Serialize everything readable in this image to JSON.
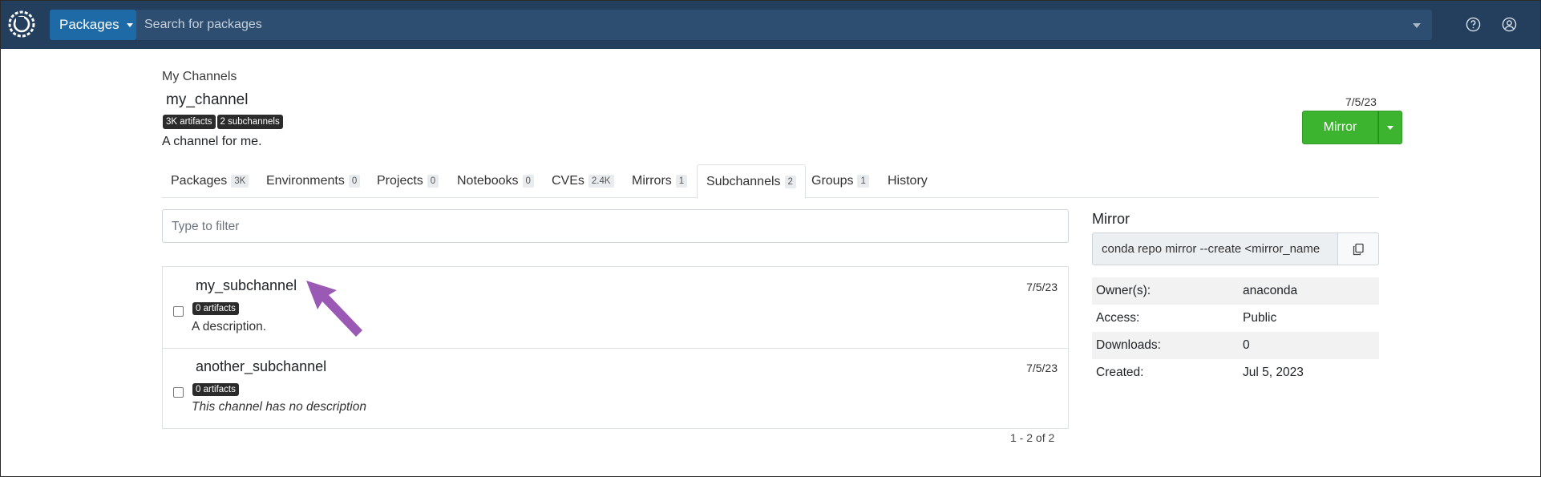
{
  "topbar": {
    "packages_label": "Packages",
    "search_placeholder": "Search for packages"
  },
  "header": {
    "breadcrumb": "My Channels",
    "title": "my_channel",
    "badges": [
      "3K artifacts",
      "2 subchannels"
    ],
    "description": "A channel for me.",
    "date": "7/5/23",
    "mirror_label": "Mirror"
  },
  "tabs": [
    {
      "label": "Packages",
      "count": "3K"
    },
    {
      "label": "Environments",
      "count": "0"
    },
    {
      "label": "Projects",
      "count": "0"
    },
    {
      "label": "Notebooks",
      "count": "0"
    },
    {
      "label": "CVEs",
      "count": "2.4K"
    },
    {
      "label": "Mirrors",
      "count": "1"
    },
    {
      "label": "Subchannels",
      "count": "2",
      "active": true
    },
    {
      "label": "Groups",
      "count": "1"
    },
    {
      "label": "History",
      "count": ""
    }
  ],
  "filter": {
    "placeholder": "Type to filter"
  },
  "subchannels": [
    {
      "name": "my_subchannel",
      "badge": "0 artifacts",
      "description": "A description.",
      "date": "7/5/23"
    },
    {
      "name": "another_subchannel",
      "badge": "0 artifacts",
      "description": "This channel has no description",
      "date": "7/5/23"
    }
  ],
  "pager": "1 - 2 of 2",
  "panel": {
    "title": "Mirror",
    "command": "conda repo mirror --create <mirror_name",
    "meta": [
      {
        "key": "Owner(s):",
        "value": "anaconda"
      },
      {
        "key": "Access:",
        "value": "Public"
      },
      {
        "key": "Downloads:",
        "value": "0"
      },
      {
        "key": "Created:",
        "value": "Jul 5, 2023"
      }
    ]
  },
  "colors": {
    "topbar": "#243f5e",
    "packages_button": "#1d6aa6",
    "mirror_button": "#3cb42f",
    "annotation_arrow": "#9b59b6"
  },
  "icons": [
    "anaconda-logo-icon",
    "help-icon",
    "user-icon",
    "copy-icon",
    "annotation-arrow-icon"
  ]
}
